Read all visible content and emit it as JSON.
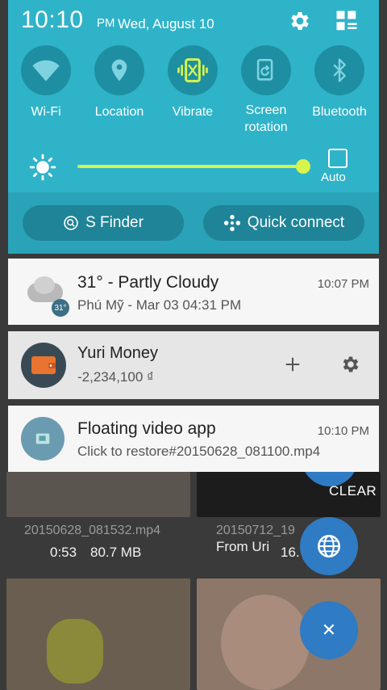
{
  "status_bar": {
    "time": "10:10",
    "ampm": "PM",
    "date": "Wed, August 10"
  },
  "quick_settings": [
    {
      "label": "Wi-Fi",
      "icon": "wifi-icon",
      "active": false
    },
    {
      "label": "Location",
      "icon": "location-icon",
      "active": false
    },
    {
      "label": "Vibrate",
      "icon": "vibrate-icon",
      "active": true
    },
    {
      "label": "Screen rotation",
      "line1": "Screen",
      "line2": "rotation",
      "icon": "screen-rotation-icon",
      "active": false
    },
    {
      "label": "Bluetooth",
      "icon": "bluetooth-icon",
      "active": false
    }
  ],
  "brightness": {
    "level": 0.95,
    "auto_label": "Auto"
  },
  "buttons": {
    "s_finder": "S Finder",
    "quick_connect": "Quick connect"
  },
  "notifications": {
    "weather": {
      "title": "31° -  Partly Cloudy",
      "subtitle": "Phú Mỹ - Mar 03  04:31 PM",
      "time": "10:07 PM",
      "badge": "31°"
    },
    "money": {
      "title": "Yuri Money",
      "subtitle": "-2,234,100 ₫"
    },
    "video": {
      "title": "Floating video app",
      "subtitle": "Click to restore#20150628_081100.mp4",
      "time": "10:10 PM"
    }
  },
  "clear_label": "CLEAR",
  "background_app": {
    "file1_name": "20150628_081532.mp4",
    "file1_duration": "0:53",
    "file1_size": "80.7 MB",
    "file2_name": "20150712_19",
    "file2_source": "From Uri",
    "file2_size": "16."
  },
  "colors": {
    "panel": "#2fb3c8",
    "accent": "#d6f44b",
    "fab": "#2f7bc4"
  }
}
